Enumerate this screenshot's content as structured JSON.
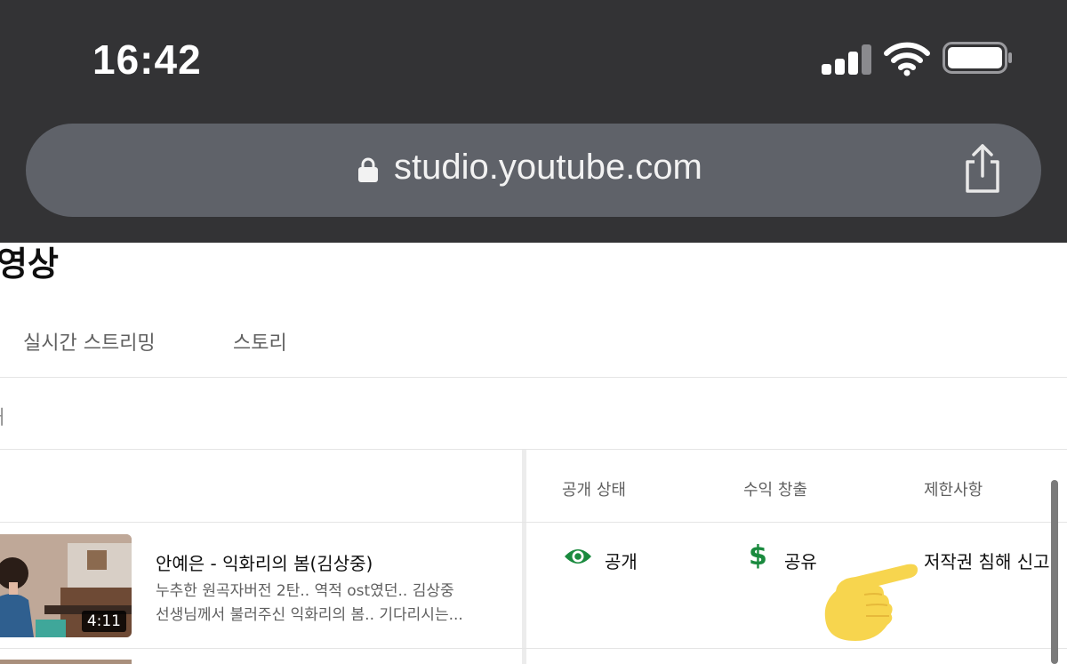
{
  "status_bar": {
    "time": "16:42",
    "signal_icon": "cellular-signal-icon",
    "wifi_icon": "wifi-icon",
    "battery_icon": "battery-icon"
  },
  "browser": {
    "url": "studio.youtube.com",
    "lock_icon": "lock-icon",
    "share_icon": "share-icon"
  },
  "page": {
    "title": "영상",
    "tabs": [
      {
        "label": "실시간 스트리밍"
      },
      {
        "label": "스토리"
      }
    ],
    "filter_fragment": "ㅓ"
  },
  "table": {
    "columns": {
      "visibility": "공개 상태",
      "monetization": "수익 창출",
      "restrictions": "제한사항"
    },
    "rows": [
      {
        "duration": "4:11",
        "title": "안예은 - 익화리의 봄(김상중)",
        "description_line1": "누추한 원곡자버전 2탄.. 역적 ost였던.. 김상중",
        "description_line2": "선생님께서 불러주신 익화리의 봄.. 기다리시는...",
        "visibility": "공개",
        "visibility_icon": "eye-icon",
        "monetization": "공유",
        "monetization_icon": "$",
        "restriction": "저작권 침해 신고"
      }
    ]
  },
  "colors": {
    "chrome_bg": "#333335",
    "urlbar_bg": "#5f6269",
    "green_status": "#1a8a3e",
    "hand_emoji": "#f6d24a"
  },
  "overlay": {
    "pointing_hand": "pointing-hand-emoji"
  }
}
